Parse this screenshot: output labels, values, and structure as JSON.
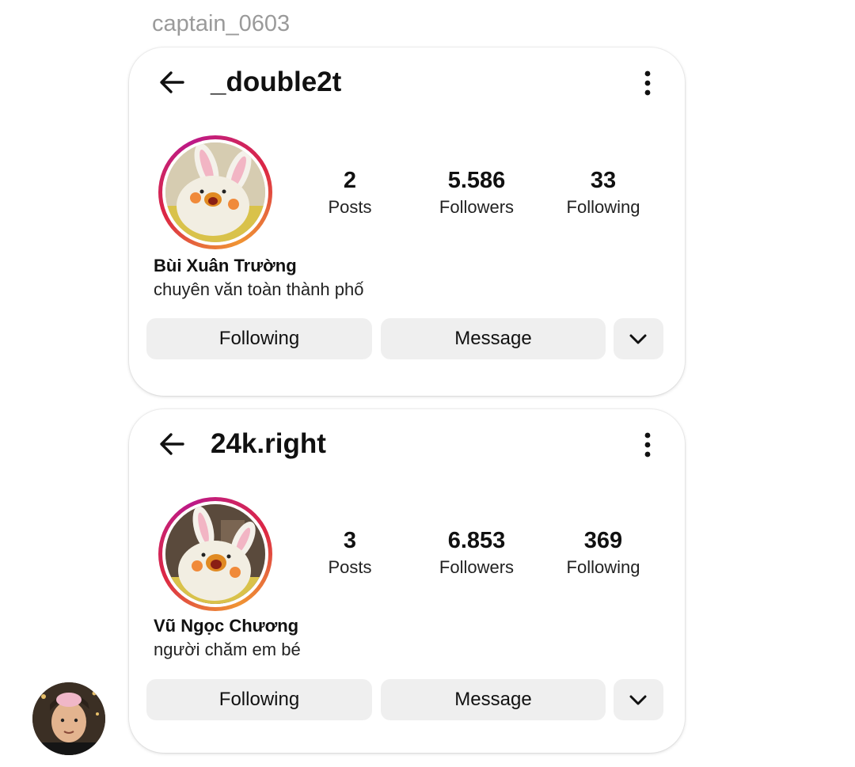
{
  "sender": {
    "name": "captain_0603"
  },
  "profiles": [
    {
      "username": "_double2t",
      "stats": [
        {
          "value": "2",
          "label": "Posts"
        },
        {
          "value": "5.586",
          "label": "Followers"
        },
        {
          "value": "33",
          "label": "Following"
        }
      ],
      "full_name": "Bùi Xuân Trường",
      "bio": "chuyên văn toàn thành phố",
      "buttons": {
        "follow": "Following",
        "message": "Message"
      }
    },
    {
      "username": "24k.right",
      "stats": [
        {
          "value": "3",
          "label": "Posts"
        },
        {
          "value": "6.853",
          "label": "Followers"
        },
        {
          "value": "369",
          "label": "Following"
        }
      ],
      "full_name": "Vũ Ngọc Chương",
      "bio": "người chăm em bé",
      "buttons": {
        "follow": "Following",
        "message": "Message"
      }
    }
  ],
  "icons": {
    "back": "arrow-left-icon",
    "more": "three-dots-vertical-icon",
    "dropdown": "chevron-down-icon"
  },
  "colors": {
    "story_ring_start": "#f09433",
    "story_ring_end": "#bc1888",
    "button_bg": "#efefef",
    "sender_name": "#9a9a9a"
  }
}
